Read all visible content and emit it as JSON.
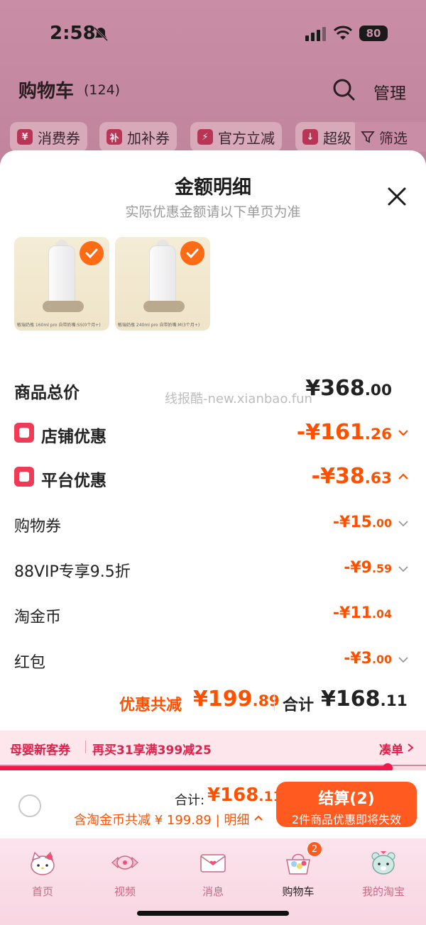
{
  "status_bar": {
    "time": "2:58",
    "battery": "80"
  },
  "header": {
    "title": "购物车",
    "count": "(124)",
    "manage_label": "管理"
  },
  "filters": [
    {
      "icon_text": "¥",
      "label": "消费券"
    },
    {
      "icon_text": "补",
      "label": "加补券"
    },
    {
      "icon_text": "⚡",
      "label": "官方立减"
    },
    {
      "icon_text": "↓",
      "label": "超级"
    }
  ],
  "filter_button": "筛选",
  "sheet": {
    "title": "金额明细",
    "subtitle": "实际优惠金额请以下单页为准",
    "products": [
      {
        "caption": "敏瑞奶瓶 160ml pro 自带奶嘴:SS(0个月+)"
      },
      {
        "caption": "敏瑞奶瓶 240ml pro 自带奶嘴:M(3个月+)"
      }
    ],
    "watermark": "线报酷-new.xianbao.fun",
    "rows": {
      "goods_total": {
        "label": "商品总价",
        "int": "¥368",
        "dec": ".00"
      },
      "store_discount": {
        "label": "店铺优惠",
        "int": "-¥161",
        "dec": ".26"
      },
      "platform_discount": {
        "label": "平台优惠",
        "int": "-¥38",
        "dec": ".63"
      },
      "shopping_coupon": {
        "label": "购物券",
        "int": "-¥15",
        "dec": ".00"
      },
      "vip_discount": {
        "label": "88VIP专享9.5折",
        "int": "-¥9",
        "dec": ".59"
      },
      "tao_coin": {
        "label": "淘金币",
        "int": "-¥11",
        "dec": ".04"
      },
      "red_packet": {
        "label": "红包",
        "int": "-¥3",
        "dec": ".00"
      }
    },
    "summary": {
      "discount_label": "优惠共减",
      "discount_int": "¥199",
      "discount_dec": ".89",
      "total_label": "合计",
      "total_int": "¥168",
      "total_dec": ".11"
    }
  },
  "coupon_banner": {
    "tag": "母婴新客券",
    "desc": "再买31享满399减25",
    "action": "凑单",
    "progress": 0.91
  },
  "checkout": {
    "total_label": "合计:",
    "total_int": "¥168",
    "total_dec": ".11",
    "sub_text": "含淘金币共减 ¥ 199.89 | 明细",
    "button_main": "结算(2)",
    "button_sub": "2件商品优惠即将失效"
  },
  "tabbar": [
    {
      "label": "首页",
      "icon": "hello-kitty-home-icon"
    },
    {
      "label": "视频",
      "icon": "candy-video-icon"
    },
    {
      "label": "消息",
      "icon": "envelope-message-icon"
    },
    {
      "label": "购物车",
      "icon": "cart-basket-icon",
      "badge": "2",
      "active": true
    },
    {
      "label": "我的淘宝",
      "icon": "bear-profile-icon"
    }
  ],
  "colors": {
    "accent": "#ff5000",
    "coupon_red": "#e0214a",
    "checkout_button": "#ff5a1f"
  }
}
